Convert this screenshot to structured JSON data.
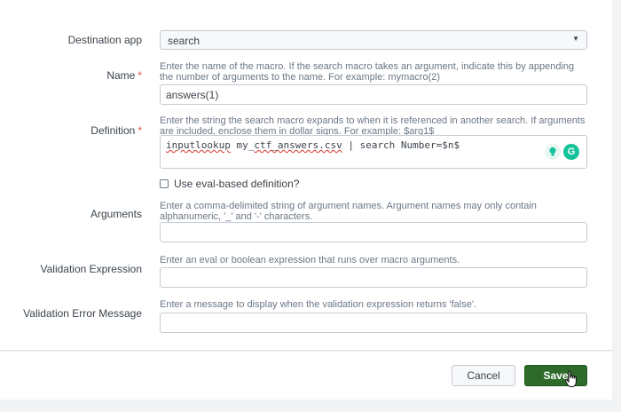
{
  "form": {
    "destination_app": {
      "label": "Destination app",
      "value": "search"
    },
    "name": {
      "label": "Name",
      "required_mark": "*",
      "help": "Enter the name of the macro. If the search macro takes an argument, indicate this by appending the number of arguments to the name. For example: mymacro(2)",
      "value": "answers(1)"
    },
    "definition": {
      "label": "Definition",
      "required_mark": "*",
      "help": "Enter the string the search macro expands to when it is referenced in another search. If arguments are included, enclose them in dollar signs. For example: $arg1$",
      "value_part1": "inputlookup",
      "value_part2": " my_",
      "value_part3": "ctf_answers.csv",
      "value_part4": " | search Number=$n$",
      "grammarly_logo": "G"
    },
    "eval_checkbox": {
      "label": "Use eval-based definition?",
      "checked": false
    },
    "arguments": {
      "label": "Arguments",
      "help": "Enter a comma-delimited string of argument names. Argument names may only contain alphanumeric, '_' and '-' characters.",
      "value": ""
    },
    "validation_expression": {
      "label": "Validation Expression",
      "help": "Enter an eval or boolean expression that runs over macro arguments.",
      "value": ""
    },
    "validation_error": {
      "label": "Validation Error Message",
      "help": "Enter a message to display when the validation expression returns 'false'.",
      "value": ""
    }
  },
  "footer": {
    "cancel_label": "Cancel",
    "save_label": "Save"
  },
  "colors": {
    "save_bg": "#2e6b2a",
    "required": "#d6563c",
    "grammarly": "#15c39a"
  },
  "icons": [
    "caret-down-icon",
    "grammarly-bulb-icon",
    "grammarly-logo-icon",
    "hand-cursor-icon"
  ]
}
